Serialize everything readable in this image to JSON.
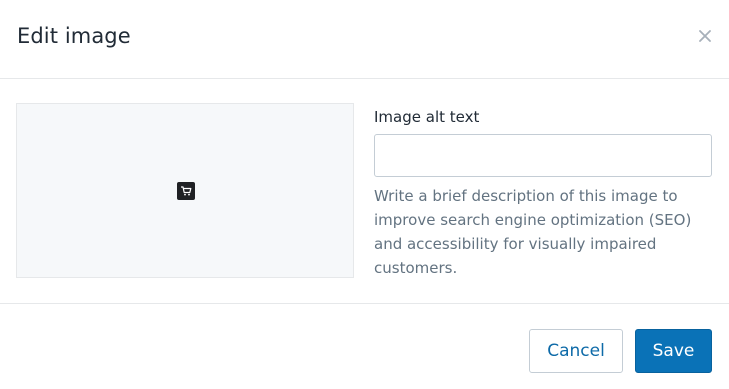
{
  "dialog": {
    "title": "Edit image",
    "close_icon": "close-icon"
  },
  "preview": {
    "placeholder_icon": "cart-icon"
  },
  "alt_text": {
    "label": "Image alt text",
    "value": "",
    "placeholder": "",
    "help": "Write a brief description of this image to improve search engine optimization (SEO) and accessibility for visually impaired customers."
  },
  "footer": {
    "cancel_label": "Cancel",
    "save_label": "Save"
  },
  "colors": {
    "primary": "#0a72b7",
    "link": "#0d6aa8",
    "border": "#c4cdd5",
    "muted_text": "#637381",
    "preview_bg": "#f6f8fa"
  }
}
